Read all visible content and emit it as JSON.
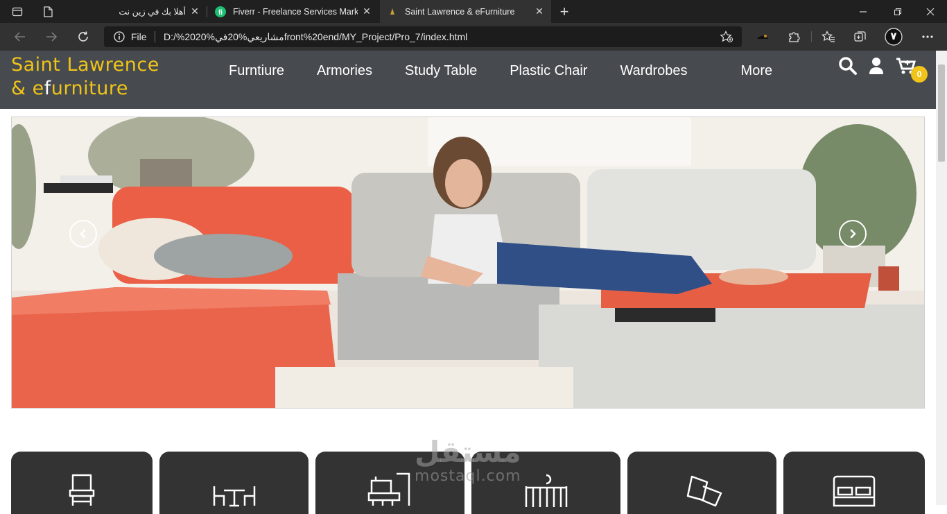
{
  "browser": {
    "tabs": [
      {
        "title": "أهلا بك في زين نت",
        "active": false
      },
      {
        "title": "Fiverr - Freelance Services Marke",
        "active": false
      },
      {
        "title": "Saint Lawrence & eFurniture",
        "active": true
      }
    ],
    "address": {
      "scheme_label": "File",
      "url": "D:/%20مشاريعي%20في%20front%20end/MY_Project/Pro_7/index.html"
    },
    "profile_initial": "٧"
  },
  "site": {
    "logo_line1": "Saint Lawrence",
    "logo_line2_amp": "& e",
    "logo_line2_f": "f",
    "logo_line2_rest": "urniture",
    "nav": [
      "Furntiure",
      "Armories",
      "Study Table",
      "Plastic Chair",
      "Wardrobes",
      "More"
    ],
    "cart_count": "0",
    "categories": [
      {
        "icon": "chair-icon"
      },
      {
        "icon": "dining-set-icon"
      },
      {
        "icon": "study-desk-icon"
      },
      {
        "icon": "crib-icon"
      },
      {
        "icon": "pillow-icon"
      },
      {
        "icon": "bed-icon"
      }
    ]
  },
  "watermark": {
    "arabic": "مستقل",
    "latin": "mostaql.com"
  },
  "colors": {
    "accent": "#f0c419",
    "header": "#474b4f",
    "card": "#333333"
  }
}
